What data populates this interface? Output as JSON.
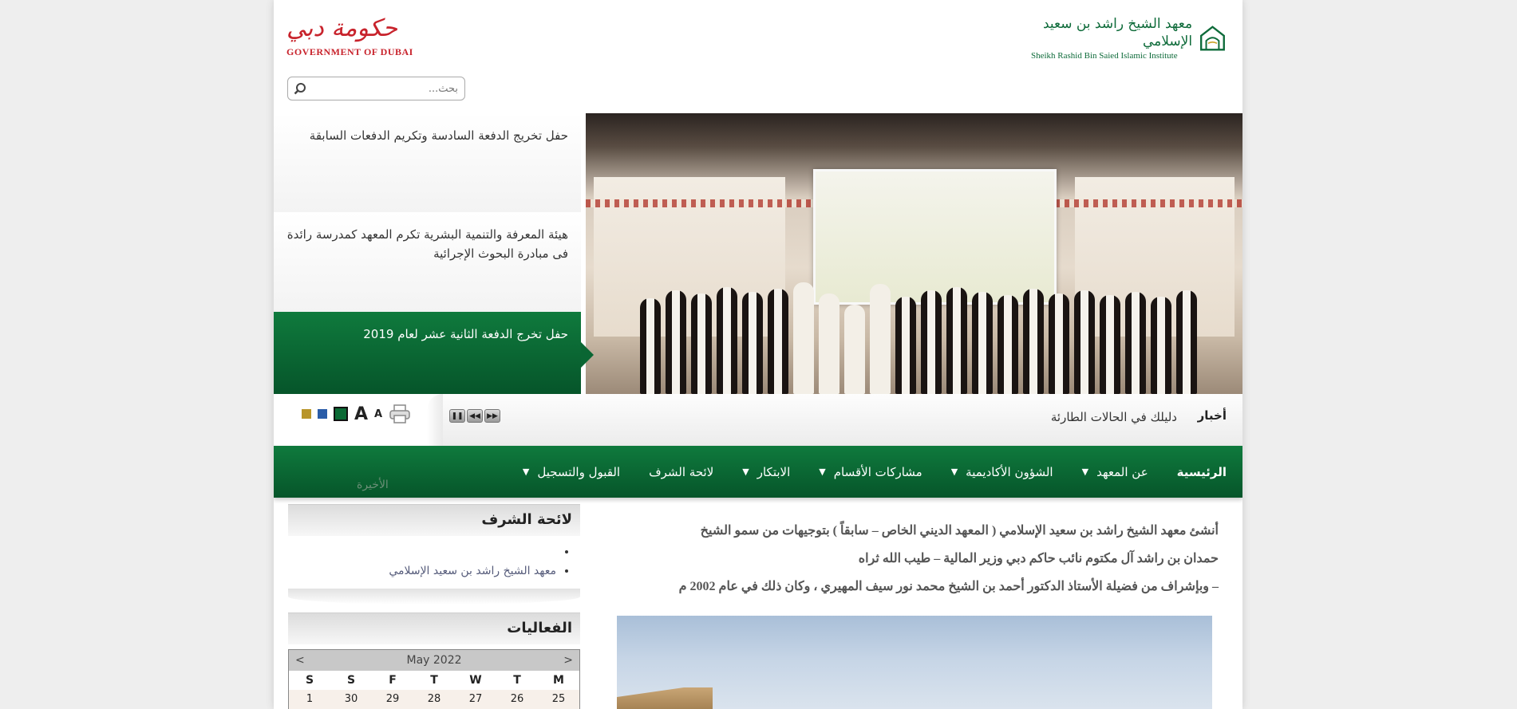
{
  "header": {
    "institute_name_ar": "معهد الشيخ راشد بن سعيد الإسلامي",
    "institute_name_en": "Sheikh Rashid Bin Saied Islamic Institute",
    "gov_name_ar": "حكومة دبي",
    "gov_name_en": "GOVERNMENT OF DUBAI",
    "search_placeholder": "بحث..."
  },
  "news": [
    "حفل تخريج الدفعة السادسة وتكريم الدفعات السابقة",
    "هيئة المعرفة والتنمية البشرية تكرم المعهد كمدرسة رائدة فى مبادرة البحوث الإجرائية",
    "حفل تخرج الدفعة الثانية عشر لعام 2019"
  ],
  "ticker": {
    "label": "أخبار",
    "text": "دليلك في الحالات الطارئة"
  },
  "nav": {
    "home": "الرئيسية",
    "items": [
      "عن المعهد",
      "الشؤون الأكاديمية",
      "مشاركات الأقسام",
      "الابتكار",
      "لائحة الشرف",
      "القبول والتسجيل"
    ],
    "ghost": "الأخيرة"
  },
  "intro": {
    "line1": "أنشئ معهد الشيخ راشد بن سعيد الإسلامي ( المعهد الديني الخاص – سابقاً ) بتوجيهات من سمو الشيخ",
    "line2": "حمدان بن راشد آل مكتوم نائب حاكم دبي وزير المالية – طيب الله ثراه",
    "line3": "– وبإشراف من فضيلة الأستاذ الدكتور أحمد بن الشيخ محمد نور سيف المهيري ، وكان ذلك في عام 2002 م"
  },
  "honor_widget": {
    "title": "لائحة الشرف",
    "items": [
      "",
      "معهد الشيخ راشد بن سعيد الإسلامي"
    ]
  },
  "events_widget": {
    "title": "الفعاليات",
    "calendar": {
      "month": "May 2022",
      "prev": "<",
      "next": ">",
      "days": [
        "S",
        "S",
        "F",
        "T",
        "W",
        "T",
        "M"
      ],
      "dates": [
        "1",
        "30",
        "29",
        "28",
        "27",
        "26",
        "25"
      ]
    }
  },
  "colors": {
    "brand_green": "#0b6a35",
    "gov_red": "#c8232c"
  }
}
